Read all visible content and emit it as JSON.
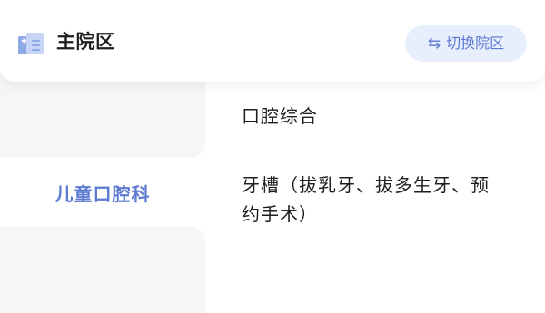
{
  "header": {
    "campus_title": "主院区",
    "switch_button": {
      "icon": "⇆",
      "label": "切换院区"
    }
  },
  "sidebar": {
    "items": [
      {
        "label": "儿童口腔科",
        "selected": true
      }
    ]
  },
  "departments": [
    {
      "label": "口腔综合"
    },
    {
      "label": "牙槽（拔乳牙、拔多生牙、预约手术）"
    }
  ],
  "colors": {
    "accent": "#5d7ad2",
    "accent_bg": "#e8effc",
    "page_bg": "#f5f6f8"
  }
}
